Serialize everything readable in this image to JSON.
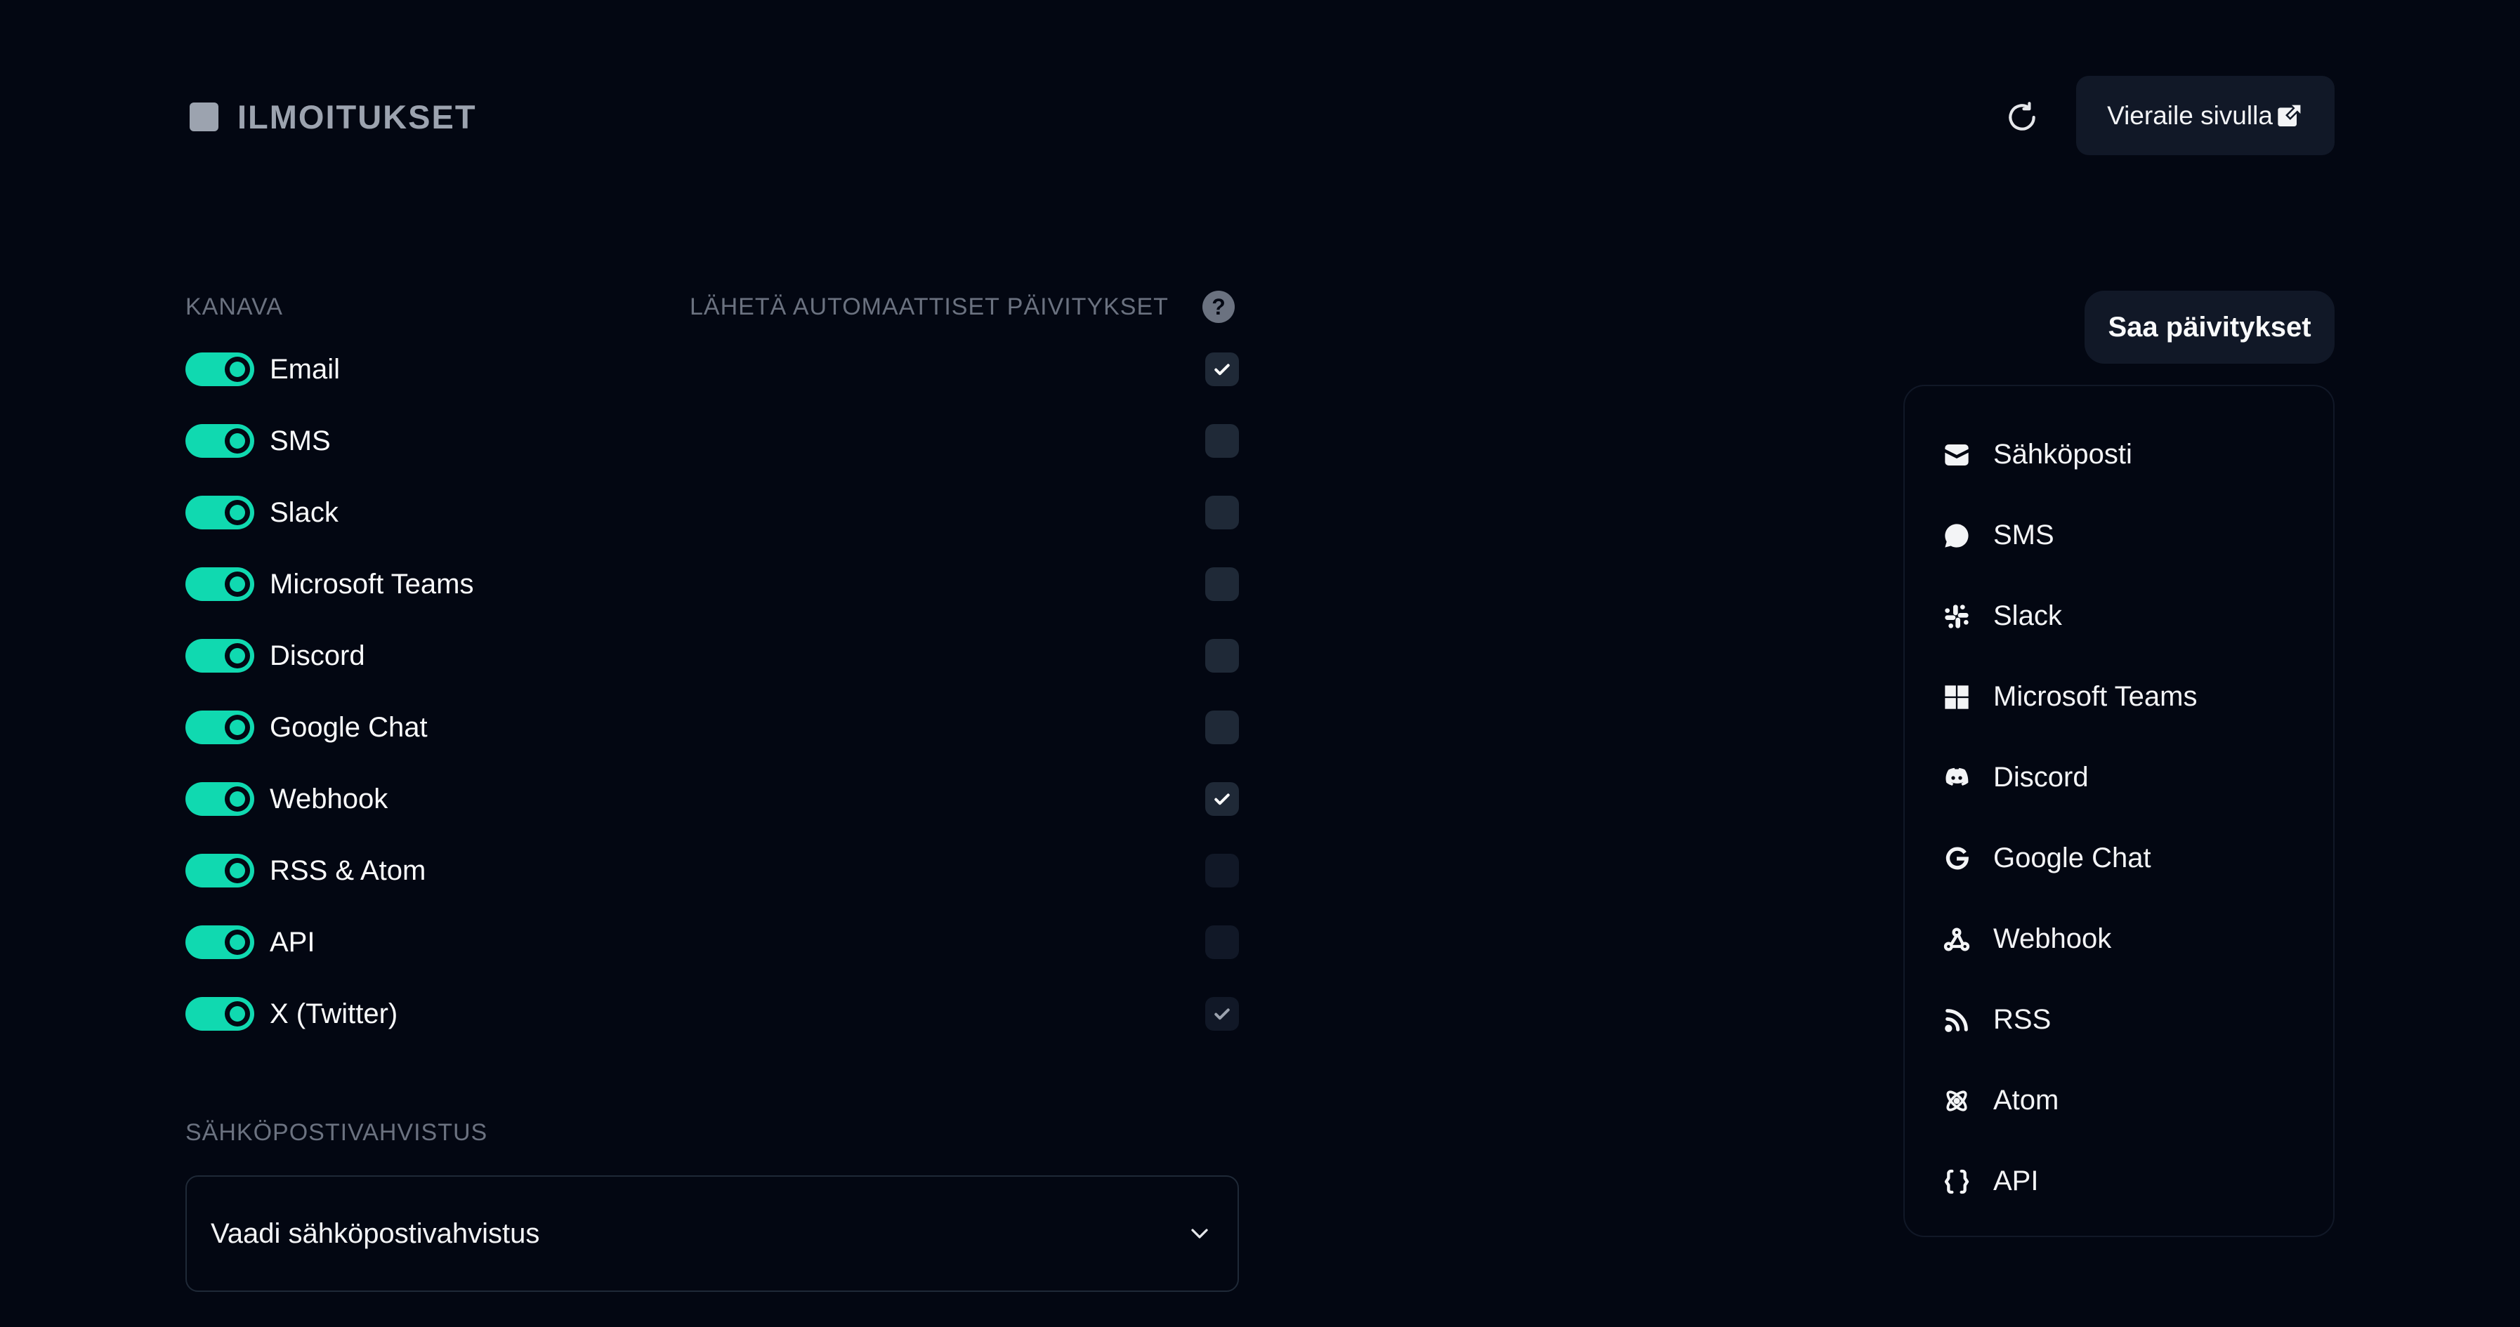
{
  "header": {
    "title": "ILMOITUKSET",
    "visit_label": "Vieraile sivulla"
  },
  "columns": {
    "channel": "KANAVA",
    "auto_updates": "LÄHETÄ AUTOMAATTISET PÄIVITYKSET"
  },
  "channels": [
    {
      "label": "Email",
      "enabled": true,
      "auto": true
    },
    {
      "label": "SMS",
      "enabled": true,
      "auto": false
    },
    {
      "label": "Slack",
      "enabled": true,
      "auto": false
    },
    {
      "label": "Microsoft Teams",
      "enabled": true,
      "auto": false
    },
    {
      "label": "Discord",
      "enabled": true,
      "auto": false
    },
    {
      "label": "Google Chat",
      "enabled": true,
      "auto": false
    },
    {
      "label": "Webhook",
      "enabled": true,
      "auto": true
    },
    {
      "label": "RSS & Atom",
      "enabled": true,
      "auto": false
    },
    {
      "label": "API",
      "enabled": true,
      "auto": false
    },
    {
      "label": "X (Twitter)",
      "enabled": true,
      "auto": true
    }
  ],
  "email_verification": {
    "label": "SÄHKÖPOSTIVAHVISTUS",
    "selected": "Vaadi sähköpostivahvistus"
  },
  "get_updates": {
    "button_label": "Saa päivitykset",
    "items": [
      {
        "label": "Sähköposti",
        "icon": "mail-icon"
      },
      {
        "label": "SMS",
        "icon": "chat-bubble-icon"
      },
      {
        "label": "Slack",
        "icon": "slack-icon"
      },
      {
        "label": "Microsoft Teams",
        "icon": "windows-icon"
      },
      {
        "label": "Discord",
        "icon": "discord-icon"
      },
      {
        "label": "Google Chat",
        "icon": "google-icon"
      },
      {
        "label": "Webhook",
        "icon": "webhook-icon"
      },
      {
        "label": "RSS",
        "icon": "rss-icon"
      },
      {
        "label": "Atom",
        "icon": "atom-icon"
      },
      {
        "label": "API",
        "icon": "braces-icon"
      }
    ]
  },
  "colors": {
    "background": "#030712",
    "accent": "#10d9b0",
    "muted": "#6b7280",
    "surface": "#111827"
  }
}
